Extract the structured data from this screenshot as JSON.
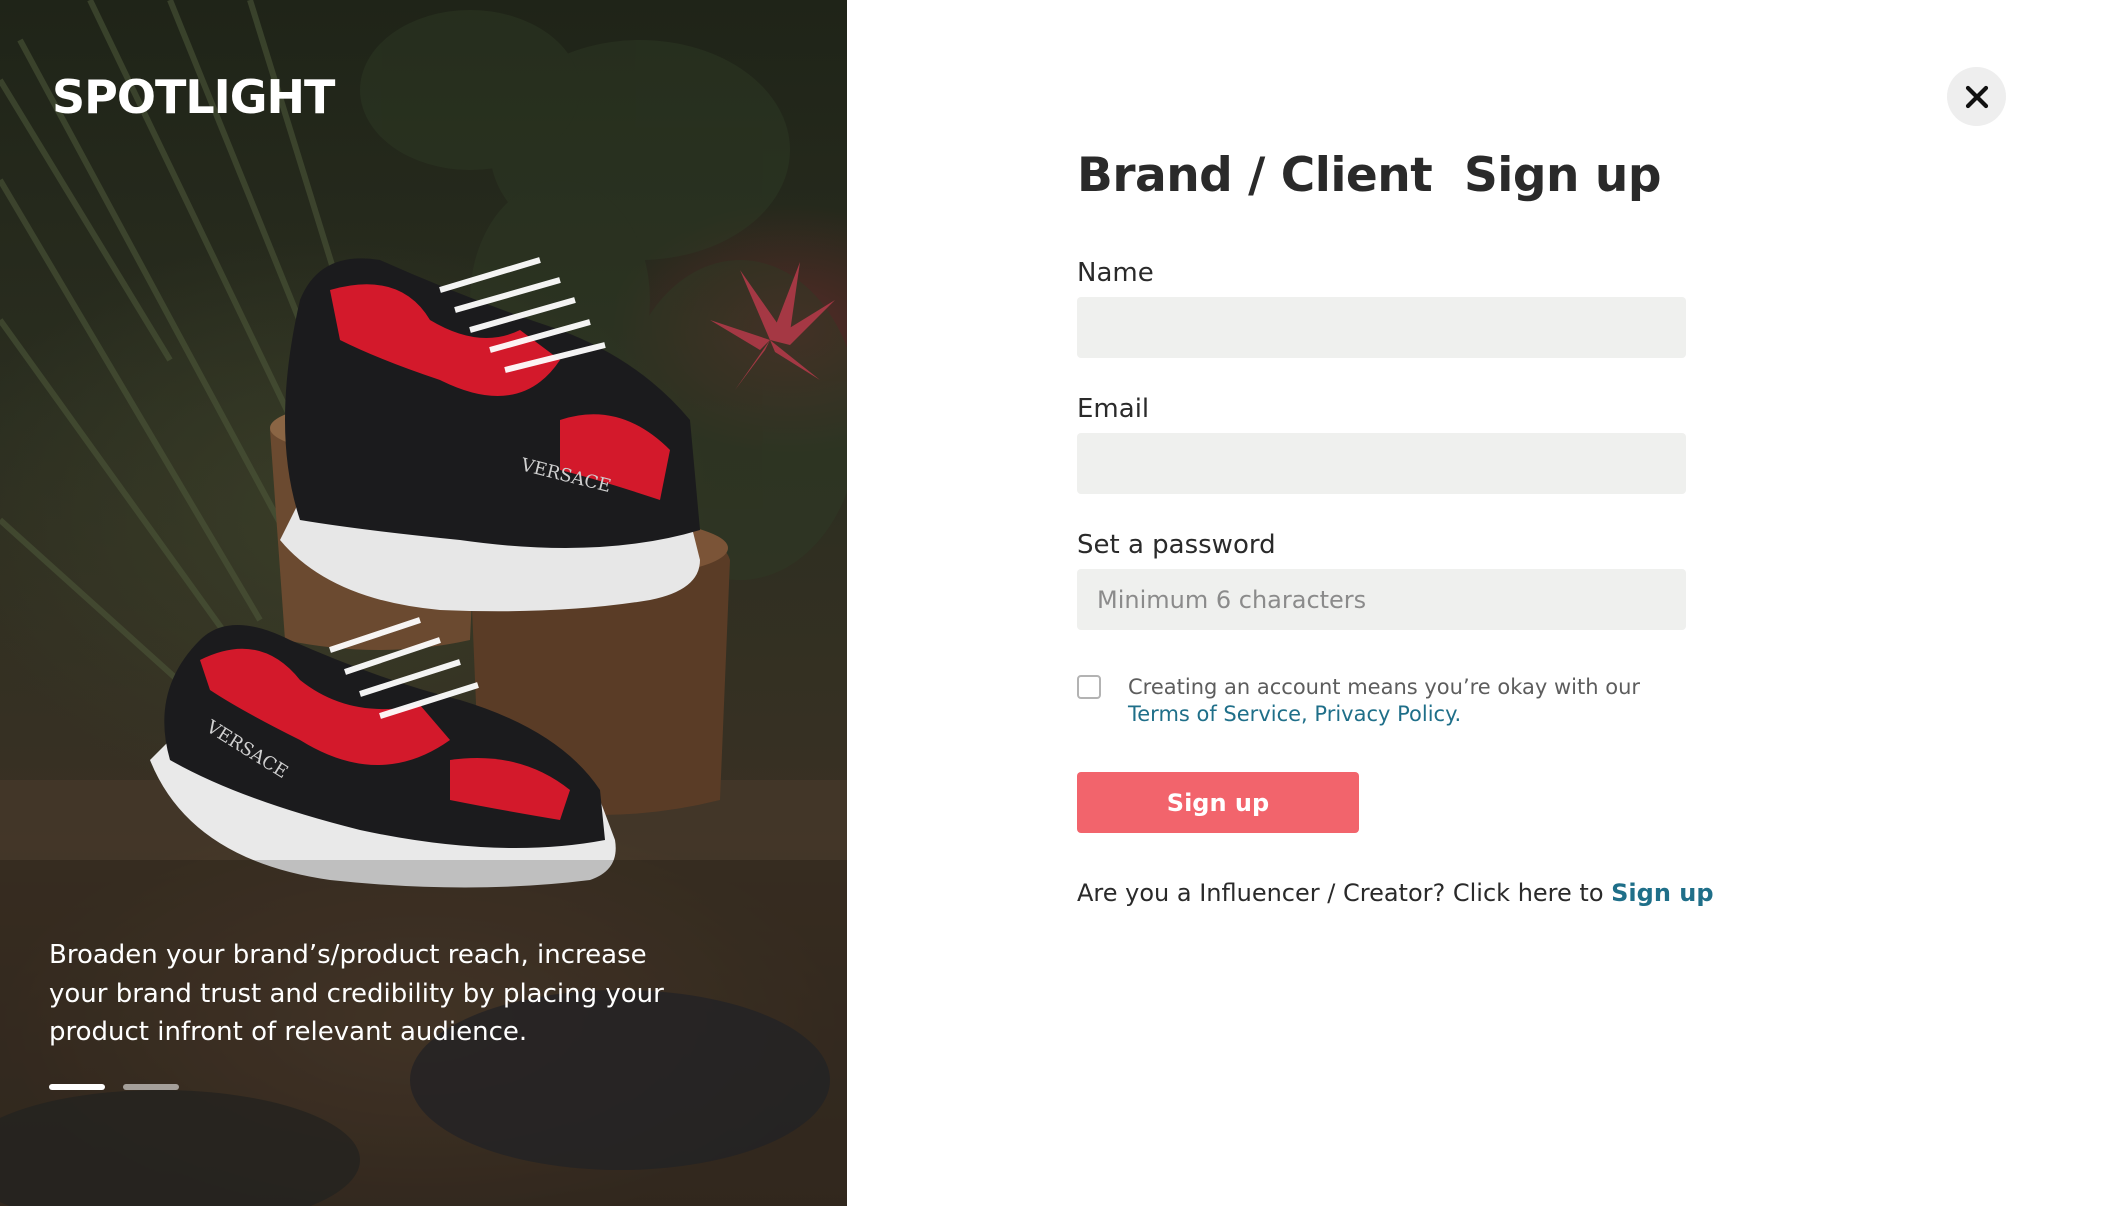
{
  "brand": {
    "logo_text": "SPOTLIGHT"
  },
  "hero": {
    "caption": "Broaden your brand’s/product reach, increase your brand trust and credibility by placing your product infront of relevant audience.",
    "image_subject": "sneakers-on-tree-stumps",
    "slides": [
      {
        "active": true
      },
      {
        "active": false
      }
    ]
  },
  "close_icon": "close-icon",
  "form": {
    "title": "Brand / Client  Sign up",
    "name_label": "Name",
    "name_value": "",
    "name_placeholder": "",
    "email_label": "Email",
    "email_value": "",
    "email_placeholder": "",
    "password_label": "Set a password",
    "password_value": "",
    "password_placeholder": "Minimum 6 characters",
    "terms_checked": false,
    "terms_text": "Creating an account means you’re okay with our",
    "terms_link": "Terms of Service",
    "terms_separator": ",",
    "privacy_link": "Privacy Policy.",
    "submit_label": "Sign up",
    "alt_prompt": "Are you a Influencer / Creator? Click here to",
    "alt_link": "Sign up"
  },
  "colors": {
    "accent": "#f2646c",
    "link": "#1f6f89",
    "input_bg": "#eff0ee",
    "close_bg": "#eeeeee"
  }
}
